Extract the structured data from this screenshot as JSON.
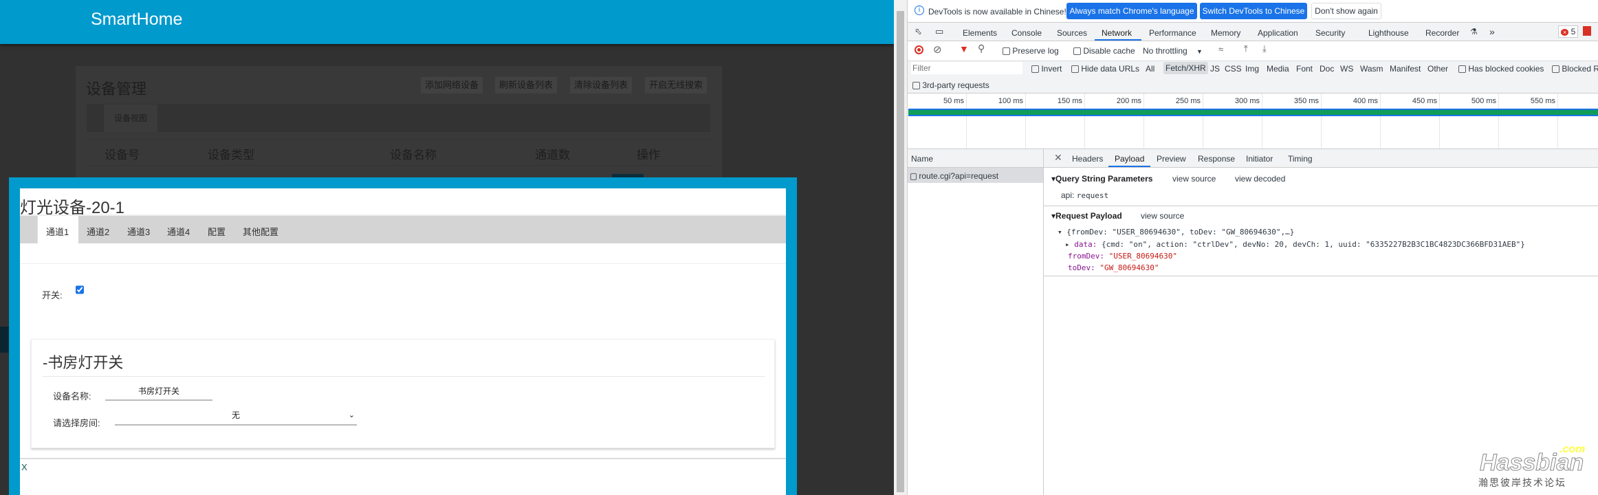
{
  "app": {
    "brand": "SmartHome",
    "page_title": "设备管理",
    "buttons": [
      "添加网络设备",
      "刷新设备列表",
      "清除设备列表",
      "开启无线搜索"
    ],
    "view_tab": "设备视图",
    "columns": [
      "设备号",
      "设备类型",
      "设备名称",
      "通道数",
      "操作"
    ]
  },
  "modal": {
    "title": "灯光设备-20-1",
    "tabs": [
      "通道1",
      "通道2",
      "通道3",
      "通道4",
      "配置",
      "其他配置"
    ],
    "switch_label": "开关:",
    "switch_checked": true,
    "card_title": "-书房灯开关",
    "name_label": "设备名称:",
    "name_value": "书房灯开关",
    "room_label": "请选择房间:",
    "room_value": "无",
    "close": "X"
  },
  "devtools": {
    "info": "DevTools is now available in Chinese!",
    "btn_match": "Always match Chrome's language",
    "btn_switch": "Switch DevTools to Chinese",
    "btn_dismiss": "Don't show again",
    "tabs": [
      "Elements",
      "Console",
      "Sources",
      "Network",
      "Performance",
      "Memory",
      "Application",
      "Security",
      "Lighthouse",
      "Recorder"
    ],
    "active_tab": "Network",
    "more": "»",
    "error_count": "5",
    "preserve_log": "Preserve log",
    "disable_cache": "Disable cache",
    "throttling": "No throttling",
    "filter_placeholder": "Filter",
    "invert": "Invert",
    "hide_data_urls": "Hide data URLs",
    "types": [
      "All",
      "Fetch/XHR",
      "JS",
      "CSS",
      "Img",
      "Media",
      "Font",
      "Doc",
      "WS",
      "Wasm",
      "Manifest",
      "Other"
    ],
    "has_blocked_cookies": "Has blocked cookies",
    "blocked": "Blocked R",
    "third_party": "3rd-party requests",
    "timeline": [
      "50 ms",
      "100 ms",
      "150 ms",
      "200 ms",
      "250 ms",
      "300 ms",
      "350 ms",
      "400 ms",
      "450 ms",
      "500 ms",
      "550 ms",
      "600"
    ],
    "name_header": "Name",
    "request": "route.cgi?api=request",
    "detail_tabs": [
      "Headers",
      "Payload",
      "Preview",
      "Response",
      "Initiator",
      "Timing"
    ],
    "qsp": "Query String Parameters",
    "view_source": "view source",
    "view_decoded": "view decoded",
    "api_key": "api:",
    "api_val": "request",
    "rp": "Request Payload",
    "obj": "{fromDev: \"USER_80694630\", toDev: \"GW_80694630\",…}",
    "data_key": "data:",
    "data_val": "{cmd: \"on\", action: \"ctrlDev\", devNo: 20, devCh: 1, uuid: \"6335227B2B3C1BC4823DC366BFD31AEB\"}",
    "from_key": "fromDev:",
    "from_val": "\"USER_80694630\"",
    "to_key": "toDev:",
    "to_val": "\"GW_80694630\""
  },
  "watermark": {
    "logo": "Hassbian",
    "com": "com",
    "text": "瀚思彼岸技术论坛"
  },
  "colors": {
    "brand": "#009acd",
    "devtools_blue": "#1a73e8"
  }
}
